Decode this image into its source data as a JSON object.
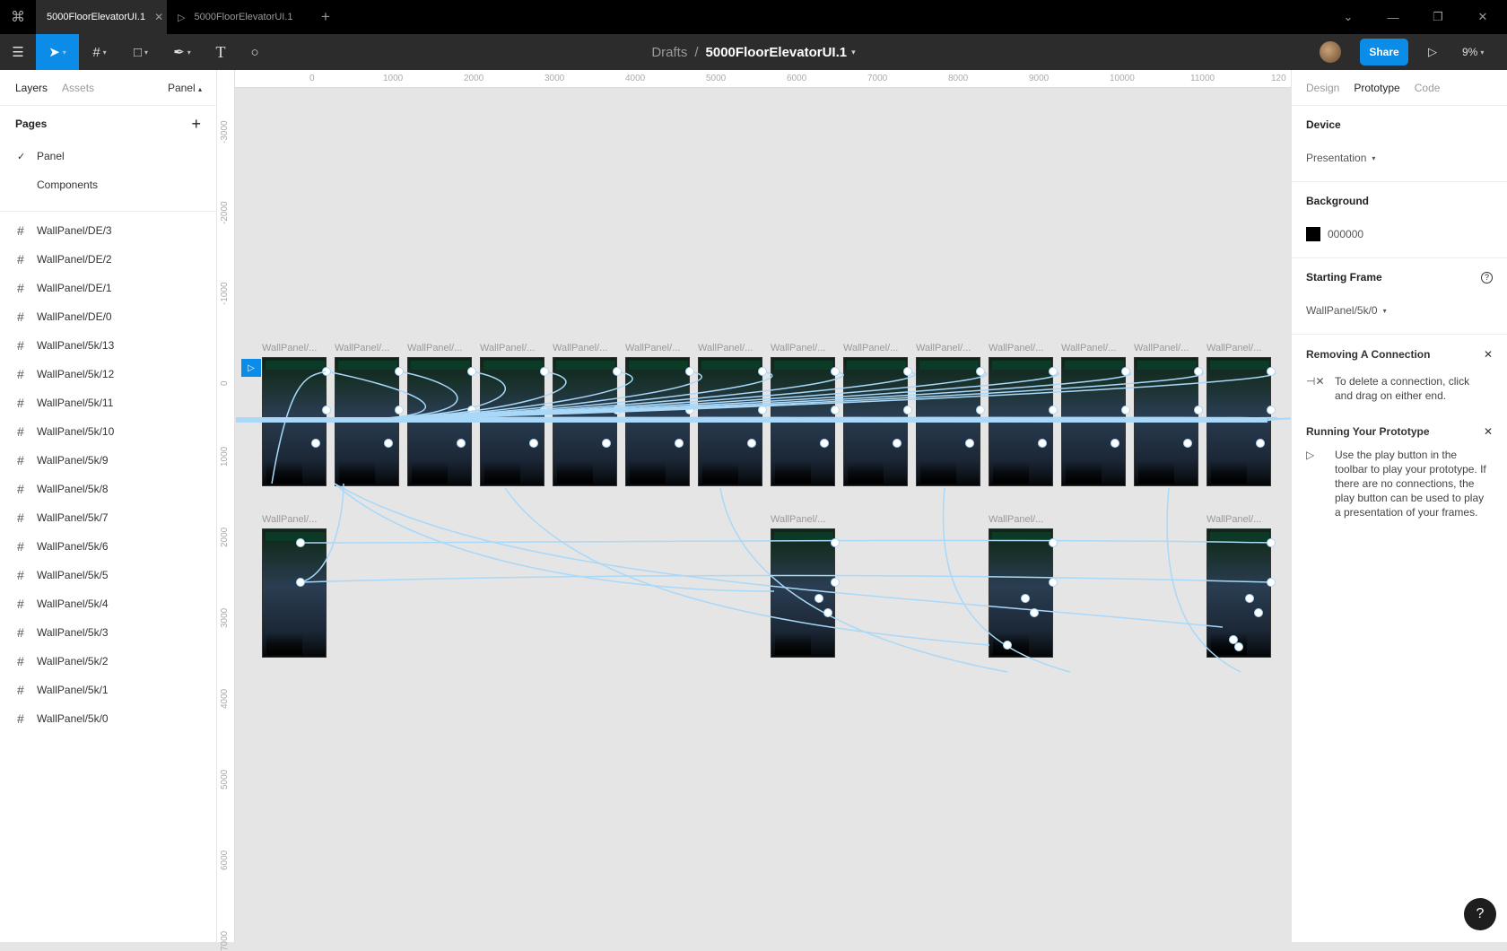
{
  "tabs": [
    {
      "label": "5000FloorElevatorUI.1",
      "active": true
    },
    {
      "label": "5000FloorElevatorUI.1",
      "active": false
    }
  ],
  "toolbar": {
    "breadcrumb_drafts": "Drafts",
    "breadcrumb_sep": "/",
    "file_name": "5000FloorElevatorUI.1",
    "share_label": "Share",
    "zoom": "9%"
  },
  "left_panel": {
    "tab_layers": "Layers",
    "tab_assets": "Assets",
    "page_selector": "Panel",
    "pages_header": "Pages",
    "pages": [
      {
        "label": "Panel",
        "selected": true
      },
      {
        "label": "Components",
        "selected": false
      }
    ],
    "layers": [
      "WallPanel/DE/3",
      "WallPanel/DE/2",
      "WallPanel/DE/1",
      "WallPanel/DE/0",
      "WallPanel/5k/13",
      "WallPanel/5k/12",
      "WallPanel/5k/11",
      "WallPanel/5k/10",
      "WallPanel/5k/9",
      "WallPanel/5k/8",
      "WallPanel/5k/7",
      "WallPanel/5k/6",
      "WallPanel/5k/5",
      "WallPanel/5k/4",
      "WallPanel/5k/3",
      "WallPanel/5k/2",
      "WallPanel/5k/1",
      "WallPanel/5k/0"
    ]
  },
  "right_panel": {
    "tabs": [
      "Design",
      "Prototype",
      "Code"
    ],
    "active_tab": "Prototype",
    "device_label": "Device",
    "device_value": "Presentation",
    "background_label": "Background",
    "background_value": "000000",
    "starting_frame_label": "Starting Frame",
    "starting_frame_value": "WallPanel/5k/0",
    "tip1_title": "Removing A Connection",
    "tip1_text": "To delete a connection, click and drag on either end.",
    "tip2_title": "Running Your Prototype",
    "tip2_text": "Use the play button in the toolbar to play your prototype. If there are no connections, the play button can be used to play a presentation of your frames."
  },
  "ruler_top": [
    "0",
    "1000",
    "2000",
    "3000",
    "4000",
    "5000",
    "6000",
    "7000",
    "8000",
    "9000",
    "10000",
    "11000",
    "120"
  ],
  "ruler_left": [
    "-3000",
    "-2000",
    "-1000",
    "0",
    "1000",
    "2000",
    "3000",
    "4000",
    "5000",
    "6000",
    "7000"
  ],
  "frame_label": "WallPanel/...",
  "help": "?"
}
